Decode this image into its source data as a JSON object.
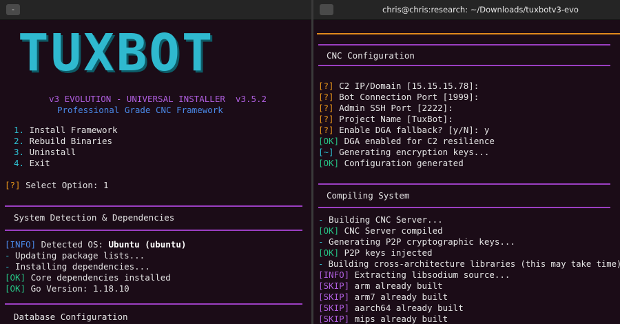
{
  "left_window": {
    "titlebar_button": "-",
    "logo_letters": [
      "T",
      "U",
      "X",
      "B",
      "O",
      "T"
    ],
    "subtitle": "v3 EVOLUTION - UNIVERSAL INSTALLER  v3.5.2",
    "tagline": "Professional Grade CNC Framework",
    "menu": [
      {
        "num": "1.",
        "label": "Install Framework"
      },
      {
        "num": "2.",
        "label": "Rebuild Binaries"
      },
      {
        "num": "3.",
        "label": "Uninstall"
      },
      {
        "num": "4.",
        "label": "Exit"
      }
    ],
    "prompt": {
      "tag": "[?]",
      "text": " Select Option: 1"
    },
    "section_detect": "System Detection & Dependencies",
    "detect_lines": [
      {
        "tag": "[INFO]",
        "text": " Detected OS: ",
        "bold": "Ubuntu (ubuntu)"
      },
      {
        "tag": "-",
        "text": " Updating package lists..."
      },
      {
        "tag": "-",
        "text": " Installing dependencies..."
      },
      {
        "tag": "[OK]",
        "text": " Core dependencies installed"
      },
      {
        "tag": "[OK]",
        "text": " Go Version: 1.18.10"
      }
    ],
    "section_database": "Database Configuration"
  },
  "right_window": {
    "title": "chris@chris:research: ~/Downloads/tuxbotv3-evo",
    "section_cnc": "CNC Configuration",
    "cnc_lines": [
      {
        "tag": "[?]",
        "text": " C2 IP/Domain [15.15.15.78]:"
      },
      {
        "tag": "[?]",
        "text": " Bot Connection Port [1999]:"
      },
      {
        "tag": "[?]",
        "text": " Admin SSH Port [2222]:"
      },
      {
        "tag": "[?]",
        "text": " Project Name [TuxBot]:"
      },
      {
        "tag": "[?]",
        "text": " Enable DGA fallback? [y/N]: y"
      },
      {
        "tag": "[OK]",
        "text": " DGA enabled for C2 resilience"
      },
      {
        "tag": "[~]",
        "text": " Generating encryption keys..."
      },
      {
        "tag": "[OK]",
        "text": " Configuration generated"
      }
    ],
    "section_compile": "Compiling System",
    "compile_lines": [
      {
        "tag": "-",
        "text": " Building CNC Server..."
      },
      {
        "tag": "[OK]",
        "text": " CNC Server compiled"
      },
      {
        "tag": "-",
        "text": " Generating P2P cryptographic keys..."
      },
      {
        "tag": "[OK]",
        "text": " P2P keys injected"
      },
      {
        "tag": "-",
        "text": " Building cross-architecture libraries (this may take time)..."
      },
      {
        "tag": "[INFO]",
        "text": " Extracting libsodium source..."
      },
      {
        "tag": "[SKIP]",
        "text": " arm already built"
      },
      {
        "tag": "[SKIP]",
        "text": " arm7 already built"
      },
      {
        "tag": "[SKIP]",
        "text": " aarch64 already built"
      },
      {
        "tag": "[SKIP]",
        "text": " mips already built"
      }
    ]
  },
  "colors": {
    "background": "#1b0c17",
    "logo": "#2fb9cf",
    "divider_purple": "#9b3fc2",
    "divider_orange": "#e08a1c",
    "tag_question": "#e8951a",
    "tag_ok": "#26c485",
    "tag_info": "#4a89e8",
    "tag_dash": "#2ec1d3",
    "tag_skip": "#b05fe0"
  }
}
